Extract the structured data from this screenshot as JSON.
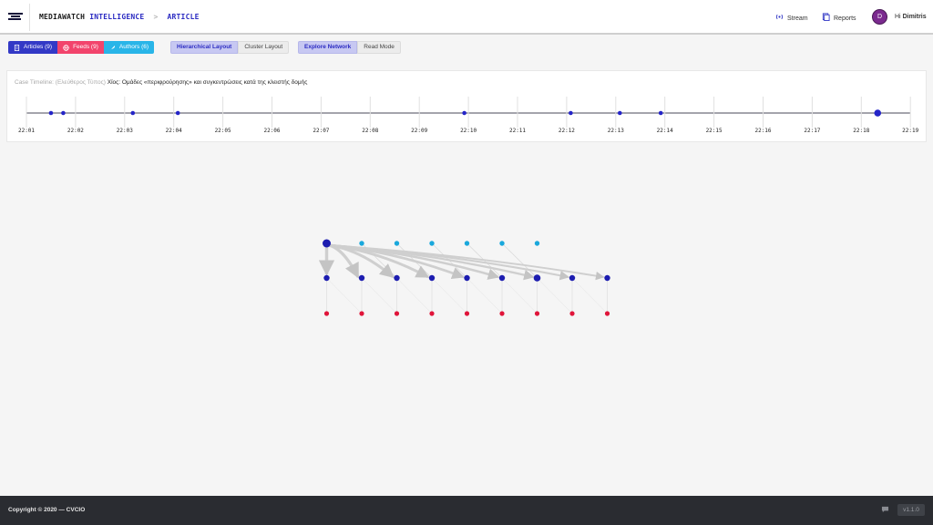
{
  "header": {
    "brand_primary": "MEDIAWATCH",
    "brand_accent": "INTELLIGENCE",
    "breadcrumb_separator": ">",
    "breadcrumb_current": "ARTICLE",
    "nav": [
      {
        "label": "Stream",
        "icon": "broadcast-icon"
      },
      {
        "label": "Reports",
        "icon": "document-icon"
      }
    ],
    "user": {
      "avatar_initial": "D",
      "greeting": "Hi",
      "name": "Dimitris"
    }
  },
  "toolbar": {
    "filters": [
      {
        "label": "Articles (9)",
        "icon": "document-icon",
        "color": "#3339c6"
      },
      {
        "label": "Feeds (9)",
        "icon": "globe-icon",
        "color": "#f2446c"
      },
      {
        "label": "Authors (6)",
        "icon": "feather-icon",
        "color": "#29b5e8"
      }
    ],
    "layout_options": [
      {
        "label": "Hierarchical Layout",
        "active": true
      },
      {
        "label": "Cluster Layout",
        "active": false
      }
    ],
    "mode_options": [
      {
        "label": "Explore Network",
        "active": true
      },
      {
        "label": "Read Mode",
        "active": false
      }
    ]
  },
  "timeline": {
    "caption_prefix": "Case Timeline: (Ελεύθερος Τύπος)",
    "caption_title": "Χίος: Ομάδες «περιφρούρησης» και συγκεντρώσεις κατά της κλειστής δομής",
    "ticks": [
      "22:01",
      "22:02",
      "22:03",
      "22:04",
      "22:05",
      "22:06",
      "22:07",
      "22:08",
      "22:09",
      "22:10",
      "22:11",
      "22:12",
      "22:13",
      "22:14",
      "22:15",
      "22:16",
      "22:17",
      "22:18",
      "22:19"
    ],
    "events": [
      "22:01:30",
      "22:01:45",
      "22:03:10",
      "22:04:05",
      "22:09:55",
      "22:12:05",
      "22:13:05",
      "22:13:55",
      "22:18:20"
    ],
    "event_color": "#2424c8"
  },
  "graph": {
    "colors": {
      "article": "#1d1db0",
      "feed": "#e0153a",
      "author": "#1aa8dc",
      "edge": "#cfcfcf"
    },
    "authors": 6,
    "articles": 9,
    "feeds": 9
  },
  "footer": {
    "copyright": "Copyright © 2020 — CVCIO",
    "chat_icon": "chat-icon",
    "version": "v1.1.0"
  }
}
